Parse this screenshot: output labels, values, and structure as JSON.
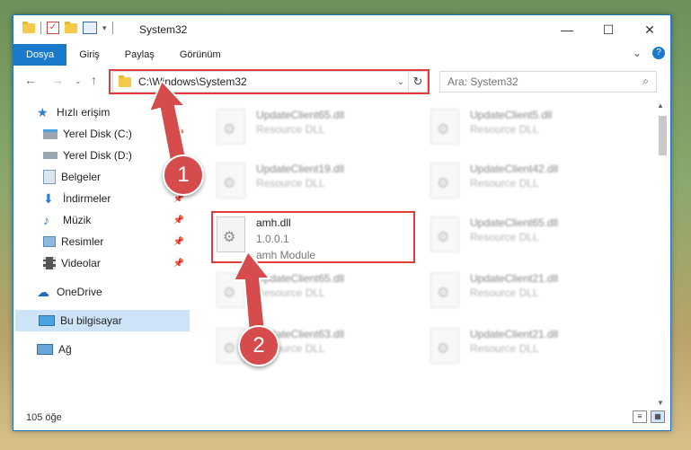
{
  "window": {
    "title": "System32"
  },
  "ribbon": {
    "tabs": [
      "Dosya",
      "Giriş",
      "Paylaş",
      "Görünüm"
    ]
  },
  "address": {
    "path": "C:\\Windows\\System32"
  },
  "search": {
    "placeholder": "Ara: System32"
  },
  "sidebar": {
    "quick_access": "Hızlı erişim",
    "items": [
      {
        "label": "Yerel Disk (C:)",
        "pinned": true
      },
      {
        "label": "Yerel Disk (D:)",
        "pinned": false
      },
      {
        "label": "Belgeler",
        "pinned": true
      },
      {
        "label": "İndirmeler",
        "pinned": true
      },
      {
        "label": "Müzik",
        "pinned": true
      },
      {
        "label": "Resimler",
        "pinned": true
      },
      {
        "label": "Videolar",
        "pinned": true
      }
    ],
    "onedrive": "OneDrive",
    "this_pc": "Bu bilgisayar",
    "network": "Ağ"
  },
  "files": {
    "left": [
      {
        "name": "UpdateClient65.dll",
        "type": "Resource DLL"
      },
      {
        "name": "UpdateClient19.dll",
        "type": "Resource DLL"
      },
      {
        "name": "amh.dll",
        "version": "1.0.0.1",
        "desc": "amh Module"
      },
      {
        "name": "UpdateClient65.dll",
        "type": "Resource DLL"
      },
      {
        "name": "UpdateClient63.dll",
        "type": "Resource DLL"
      }
    ],
    "right": [
      {
        "name": "UpdateClient5.dll",
        "type": "Resource DLL"
      },
      {
        "name": "UpdateClient42.dll",
        "type": "Resource DLL"
      },
      {
        "name": "UpdateClient65.dll",
        "type": "Resource DLL"
      },
      {
        "name": "UpdateClient21.dll",
        "type": "Resource DLL"
      },
      {
        "name": "UpdateClient21.dll",
        "type": "Resource DLL"
      }
    ]
  },
  "status": {
    "count": "105 öğe"
  },
  "annotations": {
    "badge1": "1",
    "badge2": "2",
    "color": "#d64b4b"
  }
}
